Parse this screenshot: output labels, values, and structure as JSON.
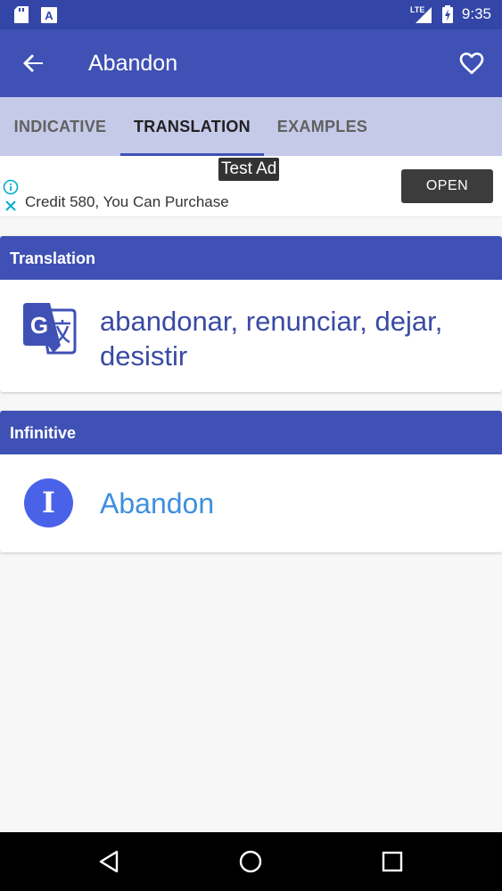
{
  "status_bar": {
    "time": "9:35",
    "network": "LTE",
    "icons": [
      "sd-card-icon",
      "app-notification-icon",
      "signal-icon",
      "battery-charging-icon"
    ]
  },
  "app_bar": {
    "title": "Abandon",
    "back_icon": "arrow-back-icon",
    "favorite_icon": "heart-outline-icon"
  },
  "tabs": {
    "items": [
      {
        "label": "INDICATIVE"
      },
      {
        "label": "TRANSLATION"
      },
      {
        "label": "EXAMPLES"
      }
    ],
    "active": "TRANSLATION"
  },
  "ad": {
    "badge": "Test Ad",
    "text": "Credit 580, You Can Purchase",
    "button": "OPEN"
  },
  "translation_card": {
    "header": "Translation",
    "icon": "google-translate-icon",
    "text": "abandonar, renunciar, dejar, desistir"
  },
  "infinitive_card": {
    "header": "Infinitive",
    "icon_letter": "I",
    "text": "Abandon"
  },
  "nav_bar": {
    "icons": [
      "back-triangle-icon",
      "home-circle-icon",
      "recents-square-icon"
    ]
  },
  "colors": {
    "primary": "#3f51b5",
    "primary_dark": "#3346a8",
    "tab_bg": "#c5cae9",
    "accent_blue": "#3d8fe0"
  }
}
